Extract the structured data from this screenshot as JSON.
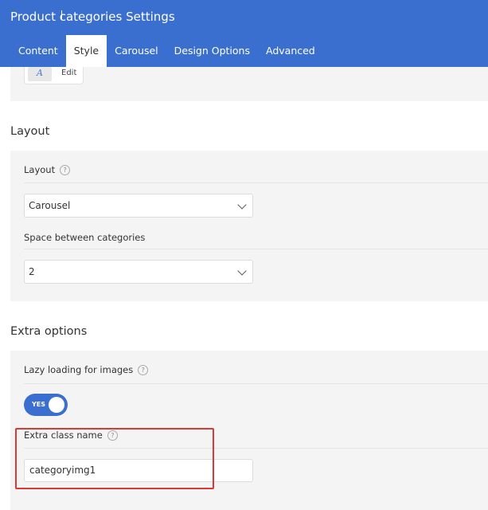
{
  "header": {
    "title": "Product categories Settings",
    "tabs": [
      {
        "label": "Content"
      },
      {
        "label": "Style"
      },
      {
        "label": "Carousel"
      },
      {
        "label": "Design Options"
      },
      {
        "label": "Advanced"
      }
    ],
    "active_tab": "Style"
  },
  "edit_box": {
    "icon_text": "A",
    "label": "Edit"
  },
  "layout_section": {
    "title": "Layout",
    "layout_label": "Layout",
    "layout_value": "Carousel",
    "space_label": "Space between categories",
    "space_value": "2",
    "help_glyph": "?"
  },
  "extra_section": {
    "title": "Extra options",
    "lazy_label": "Lazy loading for images",
    "lazy_toggle_label": "YES",
    "lazy_enabled": true,
    "class_label": "Extra class name",
    "class_value": "categoryimg1",
    "help_glyph": "?"
  },
  "colors": {
    "header_bg": "#3b6fcf",
    "highlight": "#d83a3a",
    "panel_bg": "#f4f4f4"
  }
}
